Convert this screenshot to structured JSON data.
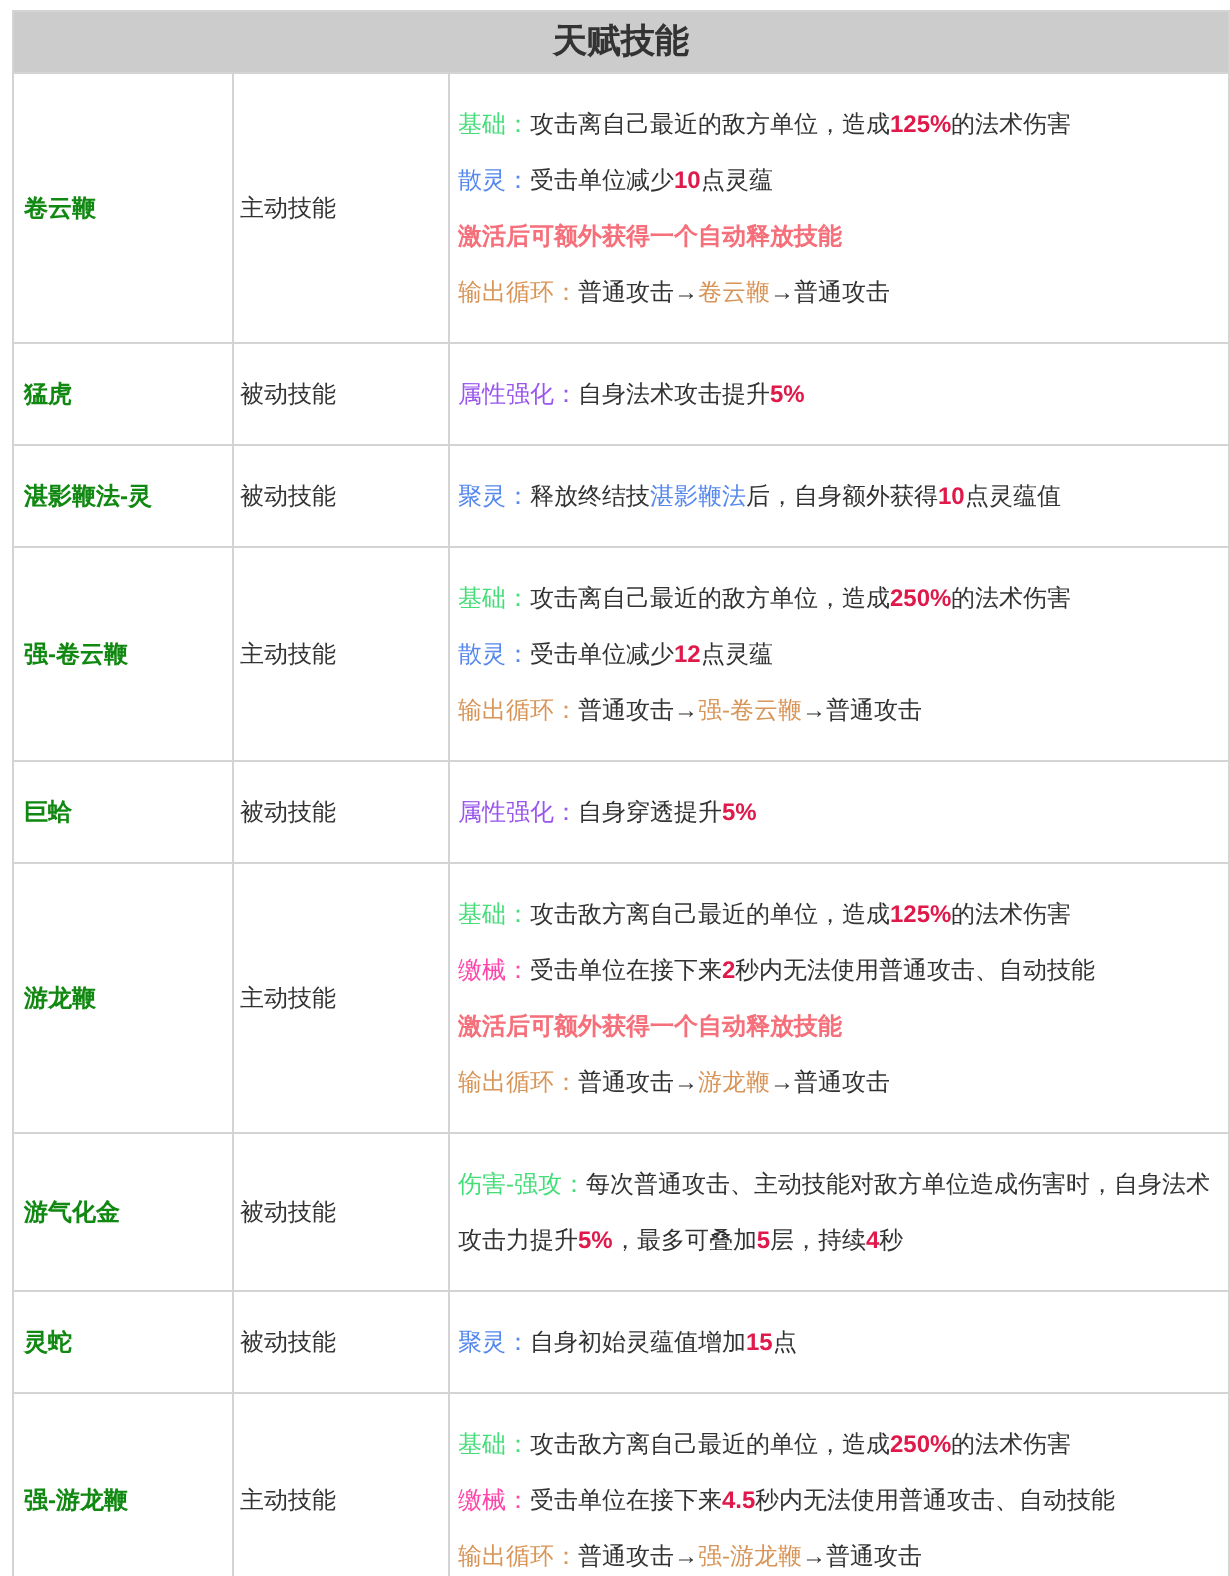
{
  "title": "天赋技能",
  "rows": [
    {
      "name": "卷云鞭",
      "type": "主动技能",
      "lines": [
        [
          {
            "kind": "label-green",
            "text": "基础："
          },
          {
            "kind": "text",
            "text": "攻击离自己最近的敌方单位，造成"
          },
          {
            "kind": "number",
            "text": "125%"
          },
          {
            "kind": "text",
            "text": "的法术伤害"
          }
        ],
        [
          {
            "kind": "label-blue",
            "text": "散灵："
          },
          {
            "kind": "text",
            "text": "受击单位减少"
          },
          {
            "kind": "number",
            "text": "10"
          },
          {
            "kind": "text",
            "text": "点灵蕴"
          }
        ],
        [
          {
            "kind": "highlight",
            "text": "激活后可额外获得一个自动释放技能"
          }
        ],
        [
          {
            "kind": "label-orange",
            "text": "输出循环："
          },
          {
            "kind": "text",
            "text": "普通攻击→"
          },
          {
            "kind": "skill-orange",
            "text": "卷云鞭"
          },
          {
            "kind": "text",
            "text": "→普通攻击"
          }
        ]
      ]
    },
    {
      "name": "猛虎",
      "type": "被动技能",
      "lines": [
        [
          {
            "kind": "label-purple",
            "text": "属性强化："
          },
          {
            "kind": "text",
            "text": "自身法术攻击提升"
          },
          {
            "kind": "number",
            "text": "5%"
          }
        ]
      ]
    },
    {
      "name": "湛影鞭法-灵",
      "type": "被动技能",
      "lines": [
        [
          {
            "kind": "label-blue",
            "text": "聚灵："
          },
          {
            "kind": "text",
            "text": "释放终结技"
          },
          {
            "kind": "skill-blue",
            "text": "湛影鞭法"
          },
          {
            "kind": "text",
            "text": "后，自身额外获得"
          },
          {
            "kind": "number",
            "text": "10"
          },
          {
            "kind": "text",
            "text": "点灵蕴值"
          }
        ]
      ]
    },
    {
      "name": "强-卷云鞭",
      "type": "主动技能",
      "lines": [
        [
          {
            "kind": "label-green",
            "text": "基础："
          },
          {
            "kind": "text",
            "text": "攻击离自己最近的敌方单位，造成"
          },
          {
            "kind": "number",
            "text": "250%"
          },
          {
            "kind": "text",
            "text": "的法术伤害"
          }
        ],
        [
          {
            "kind": "label-blue",
            "text": "散灵："
          },
          {
            "kind": "text",
            "text": "受击单位减少"
          },
          {
            "kind": "number",
            "text": "12"
          },
          {
            "kind": "text",
            "text": "点灵蕴"
          }
        ],
        [
          {
            "kind": "label-orange",
            "text": "输出循环："
          },
          {
            "kind": "text",
            "text": "普通攻击→"
          },
          {
            "kind": "skill-orange",
            "text": "强-卷云鞭"
          },
          {
            "kind": "text",
            "text": "→普通攻击"
          }
        ]
      ]
    },
    {
      "name": "巨蛤",
      "type": "被动技能",
      "lines": [
        [
          {
            "kind": "label-purple",
            "text": "属性强化："
          },
          {
            "kind": "text",
            "text": "自身穿透提升"
          },
          {
            "kind": "number",
            "text": "5%"
          }
        ]
      ]
    },
    {
      "name": "游龙鞭",
      "type": "主动技能",
      "lines": [
        [
          {
            "kind": "label-green",
            "text": "基础："
          },
          {
            "kind": "text",
            "text": "攻击敌方离自己最近的单位，造成"
          },
          {
            "kind": "number",
            "text": "125%"
          },
          {
            "kind": "text",
            "text": "的法术伤害"
          }
        ],
        [
          {
            "kind": "label-pink",
            "text": "缴械："
          },
          {
            "kind": "text",
            "text": "受击单位在接下来"
          },
          {
            "kind": "number",
            "text": "2"
          },
          {
            "kind": "text",
            "text": "秒内无法使用普通攻击、自动技能"
          }
        ],
        [
          {
            "kind": "highlight",
            "text": "激活后可额外获得一个自动释放技能"
          }
        ],
        [
          {
            "kind": "label-orange",
            "text": "输出循环："
          },
          {
            "kind": "text",
            "text": "普通攻击→"
          },
          {
            "kind": "skill-orange",
            "text": "游龙鞭"
          },
          {
            "kind": "text",
            "text": "→普通攻击"
          }
        ]
      ]
    },
    {
      "name": "游气化金",
      "type": "被动技能",
      "lines": [
        [
          {
            "kind": "label-green",
            "text": "伤害-强攻："
          },
          {
            "kind": "text",
            "text": "每次普通攻击、主动技能对敌方单位造成伤害时，自身法术攻击力提升"
          },
          {
            "kind": "number",
            "text": "5%"
          },
          {
            "kind": "text",
            "text": "，最多可叠加"
          },
          {
            "kind": "number",
            "text": "5"
          },
          {
            "kind": "text",
            "text": "层，持续"
          },
          {
            "kind": "number",
            "text": "4"
          },
          {
            "kind": "text",
            "text": "秒"
          }
        ]
      ]
    },
    {
      "name": "灵蛇",
      "type": "被动技能",
      "lines": [
        [
          {
            "kind": "label-blue",
            "text": "聚灵："
          },
          {
            "kind": "text",
            "text": "自身初始灵蕴值增加"
          },
          {
            "kind": "number",
            "text": "15"
          },
          {
            "kind": "text",
            "text": "点"
          }
        ]
      ]
    },
    {
      "name": "强-游龙鞭",
      "type": "主动技能",
      "lines": [
        [
          {
            "kind": "label-green",
            "text": "基础："
          },
          {
            "kind": "text",
            "text": "攻击敌方离自己最近的单位，造成"
          },
          {
            "kind": "number",
            "text": "250%"
          },
          {
            "kind": "text",
            "text": "的法术伤害"
          }
        ],
        [
          {
            "kind": "label-pink",
            "text": "缴械："
          },
          {
            "kind": "text",
            "text": "受击单位在接下来"
          },
          {
            "kind": "number",
            "text": "4.5"
          },
          {
            "kind": "text",
            "text": "秒内无法使用普通攻击、自动技能"
          }
        ],
        [
          {
            "kind": "label-orange",
            "text": "输出循环："
          },
          {
            "kind": "text",
            "text": "普通攻击→"
          },
          {
            "kind": "skill-orange",
            "text": "强-游龙鞭"
          },
          {
            "kind": "text",
            "text": "→普通攻击"
          }
        ]
      ]
    }
  ]
}
